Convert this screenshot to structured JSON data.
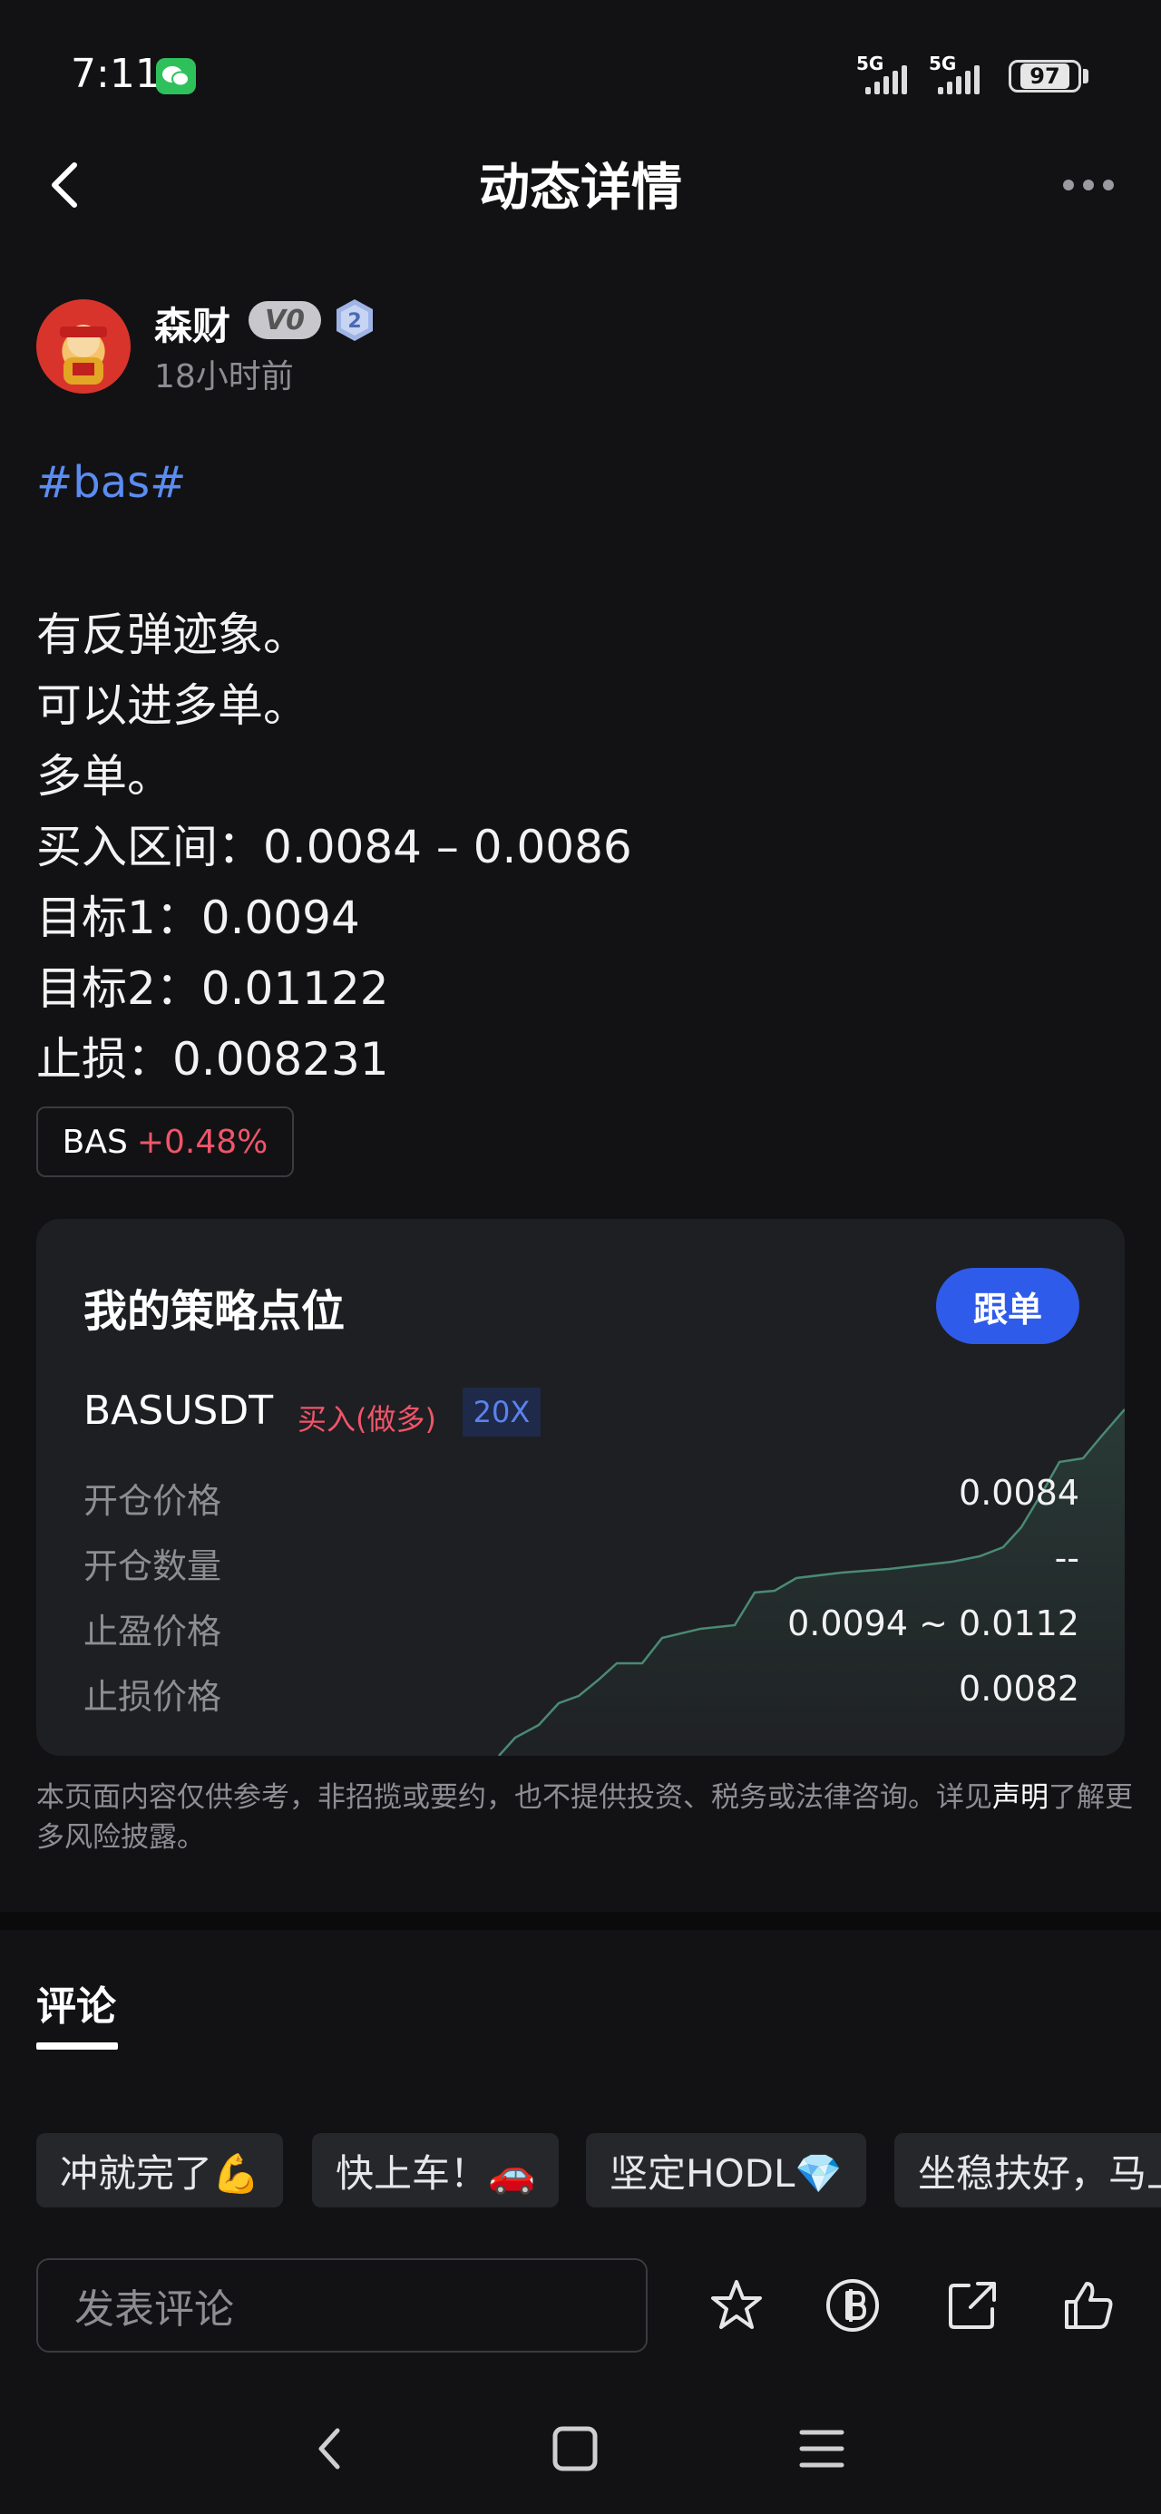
{
  "status_bar": {
    "time": "7:11",
    "network_1": "5G",
    "network_2": "5G",
    "battery": "97"
  },
  "nav": {
    "title": "动态详情"
  },
  "author": {
    "name": "森财",
    "vip_badge": "V0",
    "level": "2",
    "time": "18小时前"
  },
  "post": {
    "hashtag": "#bas#",
    "lines": [
      "有反弹迹象。",
      "可以进多单。",
      "多单。",
      "买入区间：0.0084 – 0.0086",
      "目标1：0.0094",
      "目标2：0.01122",
      "止损：0.008231"
    ]
  },
  "ticker_chip": {
    "symbol": "BAS",
    "change": "+0.48%"
  },
  "strategy": {
    "title": "我的策略点位",
    "follow_label": "跟单",
    "pair": "BASUSDT",
    "side": "买入(做多)",
    "leverage": "20X",
    "rows": [
      {
        "label": "开仓价格",
        "value": "0.0084"
      },
      {
        "label": "开仓数量",
        "value": "--"
      },
      {
        "label": "止盈价格",
        "value": "0.0094 ~ 0.0112"
      },
      {
        "label": "止损价格",
        "value": "0.0082"
      }
    ]
  },
  "disclaimer": {
    "text": "本页面内容仅供参考，非招揽或要约，也不提供投资、税务或法律咨询。详见",
    "link": "声明",
    "text_after": "了解更多风险披露。"
  },
  "comments": {
    "tab_label": "评论",
    "quick_replies": [
      "冲就完了💪",
      "快上车！🚗",
      "坚定HODL💎",
      "坐稳扶好，马上"
    ],
    "input_placeholder": "发表评论"
  },
  "colors": {
    "background": "#121214",
    "card": "#1e1f22",
    "accent_blue": "#2f5bea",
    "hashtag_blue": "#5b8cf2",
    "red": "#f0556a",
    "chart_green": "#4a8a73"
  }
}
